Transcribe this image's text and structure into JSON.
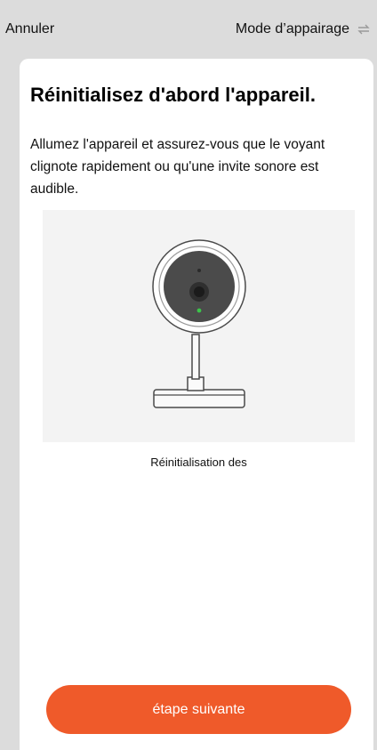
{
  "header": {
    "cancel_label": "Annuler",
    "mode_label": "Mode d’appairage"
  },
  "main": {
    "title": "Réinitialisez d'abord l'appareil.",
    "description": "Allumez l'appareil et assurez-vous que le voyant clignote rapidement ou qu'une invite sonore est audible.",
    "caption": "Réinitialisation des",
    "next_button_label": "étape suivante"
  },
  "colors": {
    "accent": "#ef5a2a",
    "background": "#dcdcdc",
    "card": "#ffffff",
    "camera_status_led": "#3cc44a"
  },
  "icons": {
    "mode_switch": "swap-arrows-icon"
  }
}
